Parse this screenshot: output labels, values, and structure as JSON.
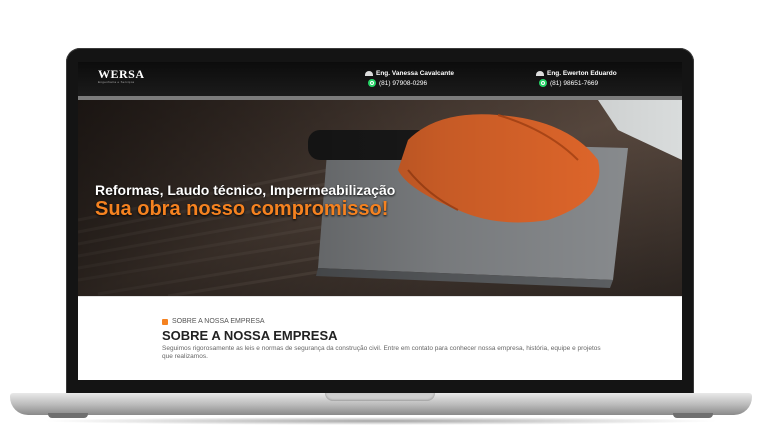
{
  "header": {
    "logo": "WERSA",
    "logo_sub": "Engenharia e Serviços",
    "contacts": [
      {
        "name": "Eng. Vanessa Cavalcante",
        "phone": "(81) 97908-0296"
      },
      {
        "name": "Eng. Ewerton Eduardo",
        "phone": "(81) 98651-7669"
      }
    ]
  },
  "hero": {
    "line1": "Reformas, Laudo técnico, Impermeabilização",
    "line2": "Sua obra nosso compromisso!"
  },
  "about": {
    "eyebrow": "SOBRE A NOSSA EMPRESA",
    "title": "SOBRE A NOSSA EMPRESA",
    "text": "Seguimos rigorosamente as leis e normas de segurança da construção civil. Entre em contato para conhecer nossa empresa, história, equipe e projetos que realizamos."
  },
  "colors": {
    "accent": "#f58220",
    "header_bg": "#111111"
  }
}
